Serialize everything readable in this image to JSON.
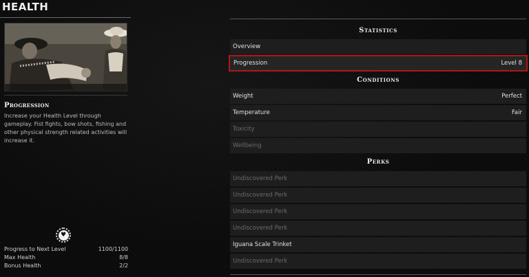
{
  "page": {
    "title": "HEALTH"
  },
  "description": {
    "heading": "Progression",
    "text": "Increase your Health Level through gameplay. Fist fights, bow shots, fishing and other physical strength related activities will increase it."
  },
  "stats": [
    {
      "label": "Progress to Next Level",
      "value": "1100/1100"
    },
    {
      "label": "Max Health",
      "value": "8/8"
    },
    {
      "label": "Bonus Health",
      "value": "2/2"
    }
  ],
  "sections": {
    "statistics": {
      "title": "Statistics",
      "rows": [
        {
          "label": "Overview",
          "value": ""
        },
        {
          "label": "Progression",
          "value": "Level 8"
        }
      ]
    },
    "conditions": {
      "title": "Conditions",
      "rows": [
        {
          "label": "Weight",
          "value": "Perfect"
        },
        {
          "label": "Temperature",
          "value": "Fair"
        },
        {
          "label": "Toxicity",
          "value": ""
        },
        {
          "label": "Wellbeing",
          "value": ""
        }
      ]
    },
    "perks": {
      "title": "Perks",
      "rows": [
        {
          "label": "Undiscovered Perk",
          "value": ""
        },
        {
          "label": "Undiscovered Perk",
          "value": ""
        },
        {
          "label": "Undiscovered Perk",
          "value": ""
        },
        {
          "label": "Undiscovered Perk",
          "value": ""
        },
        {
          "label": "Iguana Scale Trinket",
          "value": ""
        },
        {
          "label": "Undiscovered Perk",
          "value": ""
        }
      ]
    }
  },
  "colors": {
    "selection_border": "#b01818",
    "row_bg": "#1e1e1e",
    "dim_text": "#6c6c6c"
  },
  "icons": {
    "health": "heart-icon"
  }
}
